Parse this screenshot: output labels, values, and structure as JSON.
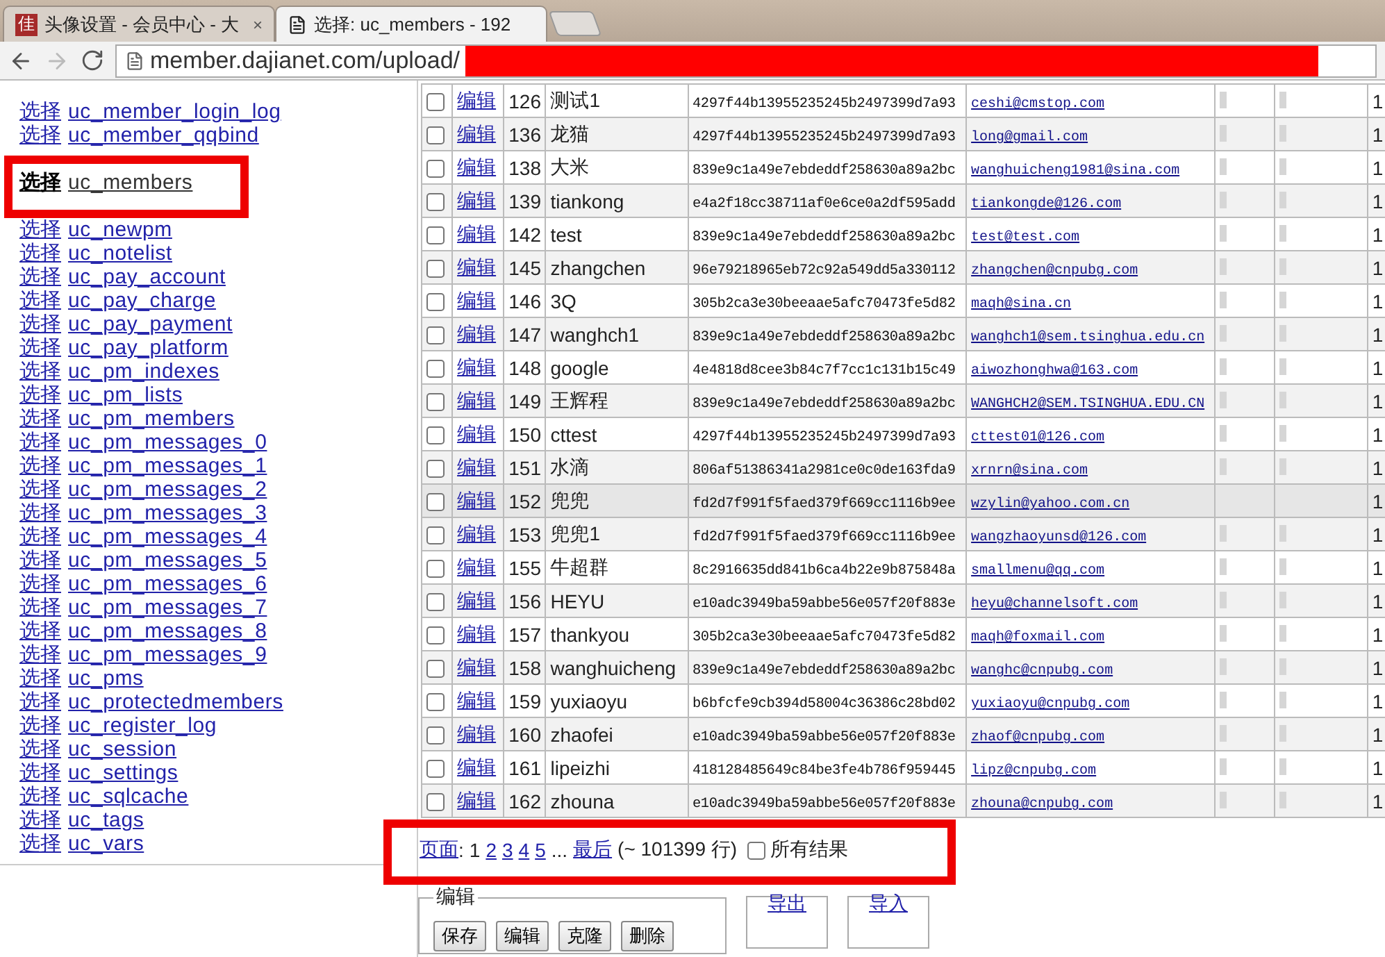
{
  "browser": {
    "tabs": [
      {
        "favicon": "佳",
        "title": "头像设置 - 会员中心 - 大",
        "close": "×",
        "selected": false
      },
      {
        "title": "选择: uc_members - 192",
        "selected": true
      }
    ],
    "address": {
      "url": "member.dajianet.com/upload/"
    }
  },
  "table_list": [
    {
      "action": "选择",
      "table": "uc_member_login_log",
      "selected": false
    },
    {
      "action": "选择",
      "table": "uc_member_qqbind",
      "selected": false
    },
    {
      "action": "选择",
      "table": "uc_members",
      "selected": true
    },
    {
      "action": "选择",
      "table": "uc_newpm",
      "selected": false
    },
    {
      "action": "选择",
      "table": "uc_notelist",
      "selected": false
    },
    {
      "action": "选择",
      "table": "uc_pay_account",
      "selected": false
    },
    {
      "action": "选择",
      "table": "uc_pay_charge",
      "selected": false
    },
    {
      "action": "选择",
      "table": "uc_pay_payment",
      "selected": false
    },
    {
      "action": "选择",
      "table": "uc_pay_platform",
      "selected": false
    },
    {
      "action": "选择",
      "table": "uc_pm_indexes",
      "selected": false
    },
    {
      "action": "选择",
      "table": "uc_pm_lists",
      "selected": false
    },
    {
      "action": "选择",
      "table": "uc_pm_members",
      "selected": false
    },
    {
      "action": "选择",
      "table": "uc_pm_messages_0",
      "selected": false
    },
    {
      "action": "选择",
      "table": "uc_pm_messages_1",
      "selected": false
    },
    {
      "action": "选择",
      "table": "uc_pm_messages_2",
      "selected": false
    },
    {
      "action": "选择",
      "table": "uc_pm_messages_3",
      "selected": false
    },
    {
      "action": "选择",
      "table": "uc_pm_messages_4",
      "selected": false
    },
    {
      "action": "选择",
      "table": "uc_pm_messages_5",
      "selected": false
    },
    {
      "action": "选择",
      "table": "uc_pm_messages_6",
      "selected": false
    },
    {
      "action": "选择",
      "table": "uc_pm_messages_7",
      "selected": false
    },
    {
      "action": "选择",
      "table": "uc_pm_messages_8",
      "selected": false
    },
    {
      "action": "选择",
      "table": "uc_pm_messages_9",
      "selected": false
    },
    {
      "action": "选择",
      "table": "uc_pms",
      "selected": false
    },
    {
      "action": "选择",
      "table": "uc_protectedmembers",
      "selected": false
    },
    {
      "action": "选择",
      "table": "uc_register_log",
      "selected": false
    },
    {
      "action": "选择",
      "table": "uc_session",
      "selected": false
    },
    {
      "action": "选择",
      "table": "uc_settings",
      "selected": false
    },
    {
      "action": "选择",
      "table": "uc_sqlcache",
      "selected": false
    },
    {
      "action": "选择",
      "table": "uc_tags",
      "selected": false
    },
    {
      "action": "选择",
      "table": "uc_vars",
      "selected": false
    }
  ],
  "rows": [
    {
      "checked": false,
      "highlighted": false,
      "edit": "编辑",
      "uid": "126",
      "username": "测试1",
      "password": "4297f44b13955235245b2497399d7a93",
      "email": "ceshi@cmstop.com",
      "column_9": "1"
    },
    {
      "checked": false,
      "highlighted": false,
      "edit": "编辑",
      "uid": "136",
      "username": "龙猫",
      "password": "4297f44b13955235245b2497399d7a93",
      "email": "long@gmail.com",
      "column_9": "1"
    },
    {
      "checked": false,
      "highlighted": false,
      "edit": "编辑",
      "uid": "138",
      "username": "大米",
      "password": "839e9c1a49e7ebdeddf258630a89a2bc",
      "email": "wanghuicheng1981@sina.com",
      "column_9": "1"
    },
    {
      "checked": false,
      "highlighted": false,
      "edit": "编辑",
      "uid": "139",
      "username": "tiankong",
      "password": "e4a2f18cc38711af0e6ce0a2df595add",
      "email": "tiankongde@126.com",
      "column_9": "1"
    },
    {
      "checked": false,
      "highlighted": false,
      "edit": "编辑",
      "uid": "142",
      "username": "test",
      "password": "839e9c1a49e7ebdeddf258630a89a2bc",
      "email": "test@test.com",
      "column_9": "1"
    },
    {
      "checked": false,
      "highlighted": false,
      "edit": "编辑",
      "uid": "145",
      "username": "zhangchen",
      "password": "96e79218965eb72c92a549dd5a330112",
      "email": "zhangchen@cnpubg.com",
      "column_9": "1"
    },
    {
      "checked": false,
      "highlighted": false,
      "edit": "编辑",
      "uid": "146",
      "username": "3Q",
      "password": "305b2ca3e30beeaae5afc70473fe5d82",
      "email": "maqh@sina.cn",
      "column_9": "1"
    },
    {
      "checked": false,
      "highlighted": false,
      "edit": "编辑",
      "uid": "147",
      "username": "wanghch1",
      "password": "839e9c1a49e7ebdeddf258630a89a2bc",
      "email": "wanghch1@sem.tsinghua.edu.cn",
      "column_9": "1"
    },
    {
      "checked": false,
      "highlighted": false,
      "edit": "编辑",
      "uid": "148",
      "username": "google",
      "password": "4e4818d8cee3b84c7f7cc1c131b15c49",
      "email": "aiwozhonghwa@163.com",
      "column_9": "1"
    },
    {
      "checked": false,
      "highlighted": false,
      "edit": "编辑",
      "uid": "149",
      "username": "王辉程",
      "password": "839e9c1a49e7ebdeddf258630a89a2bc",
      "email": "WANGHCH2@SEM.TSINGHUA.EDU.CN",
      "column_9": "1"
    },
    {
      "checked": false,
      "highlighted": false,
      "edit": "编辑",
      "uid": "150",
      "username": "cttest",
      "password": "4297f44b13955235245b2497399d7a93",
      "email": "cttest01@126.com",
      "column_9": "1"
    },
    {
      "checked": false,
      "highlighted": false,
      "edit": "编辑",
      "uid": "151",
      "username": "水滴",
      "password": "806af51386341a2981ce0c0de163fda9",
      "email": "xrnrn@sina.com",
      "column_9": "1"
    },
    {
      "checked": false,
      "highlighted": true,
      "edit": "编辑",
      "uid": "152",
      "username": "兜兜",
      "password": "fd2d7f991f5faed379f669cc1116b9ee",
      "email": "wzylin@yahoo.com.cn",
      "column_9": "1"
    },
    {
      "checked": false,
      "highlighted": false,
      "edit": "编辑",
      "uid": "153",
      "username": "兜兜1",
      "password": "fd2d7f991f5faed379f669cc1116b9ee",
      "email": "wangzhaoyunsd@126.com",
      "column_9": "1"
    },
    {
      "checked": false,
      "highlighted": false,
      "edit": "编辑",
      "uid": "155",
      "username": "牛超群",
      "password": "8c2916635dd841b6ca4b22e9b875848a",
      "email": "smallmenu@qq.com",
      "column_9": "1"
    },
    {
      "checked": false,
      "highlighted": false,
      "edit": "编辑",
      "uid": "156",
      "username": "HEYU",
      "password": "e10adc3949ba59abbe56e057f20f883e",
      "email": "heyu@channelsoft.com",
      "column_9": "1"
    },
    {
      "checked": false,
      "highlighted": false,
      "edit": "编辑",
      "uid": "157",
      "username": "thankyou",
      "password": "305b2ca3e30beeaae5afc70473fe5d82",
      "email": "maqh@foxmail.com",
      "column_9": "1"
    },
    {
      "checked": false,
      "highlighted": false,
      "edit": "编辑",
      "uid": "158",
      "username": "wanghuicheng",
      "password": "839e9c1a49e7ebdeddf258630a89a2bc",
      "email": "wanghc@cnpubg.com",
      "column_9": "1"
    },
    {
      "checked": false,
      "highlighted": false,
      "edit": "编辑",
      "uid": "159",
      "username": "yuxiaoyu",
      "password": "b6bfcfe9cb394d58004c36386c28bd02",
      "email": "yuxiaoyu@cnpubg.com",
      "column_9": "1"
    },
    {
      "checked": false,
      "highlighted": false,
      "edit": "编辑",
      "uid": "160",
      "username": "zhaofei",
      "password": "e10adc3949ba59abbe56e057f20f883e",
      "email": "zhaof@cnpubg.com",
      "column_9": "1"
    },
    {
      "checked": false,
      "highlighted": false,
      "edit": "编辑",
      "uid": "161",
      "username": "lipeizhi",
      "password": "418128485649c84be3fe4b786f959445",
      "email": "lipz@cnpubg.com",
      "column_9": "1"
    },
    {
      "checked": false,
      "highlighted": false,
      "edit": "编辑",
      "uid": "162",
      "username": "zhouna",
      "password": "e10adc3949ba59abbe56e057f20f883e",
      "email": "zhouna@cnpubg.com",
      "column_9": "1"
    }
  ],
  "pagination": {
    "label": "页面",
    "separator": ":",
    "pages": [
      {
        "text": "1",
        "selected": true
      },
      {
        "text": "2",
        "selected": false
      },
      {
        "text": "3",
        "selected": false
      },
      {
        "text": "4",
        "selected": false
      },
      {
        "text": "5",
        "selected": false
      }
    ],
    "ellipsis": "...",
    "last": "最后",
    "count": "(~ 101399 行)",
    "all_results": {
      "label": "所有结果",
      "checked": false
    }
  },
  "edit_group": {
    "legend": "编辑",
    "buttons": [
      "保存",
      "编辑",
      "克隆",
      "删除"
    ]
  },
  "links": [
    "导出",
    "导入"
  ]
}
